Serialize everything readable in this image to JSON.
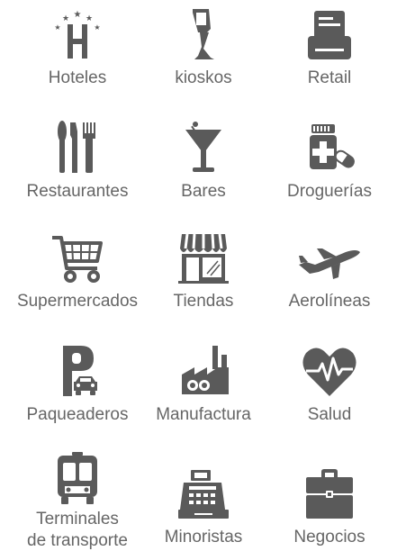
{
  "colors": {
    "icon": "#5a5a5a",
    "text": "#666666",
    "background": "#ffffff"
  },
  "items": [
    {
      "label": "Hoteles",
      "icon": "hotel-icon"
    },
    {
      "label": "kioskos",
      "icon": "kiosk-icon"
    },
    {
      "label": "Retail",
      "icon": "retail-printer-icon"
    },
    {
      "label": "Restaurantes",
      "icon": "restaurant-utensils-icon"
    },
    {
      "label": "Bares",
      "icon": "cocktail-glass-icon"
    },
    {
      "label": "Droguerías",
      "icon": "pharmacy-icon"
    },
    {
      "label": "Supermercados",
      "icon": "shopping-cart-icon"
    },
    {
      "label": "Tiendas",
      "icon": "storefront-icon"
    },
    {
      "label": "Aerolíneas",
      "icon": "airplane-icon"
    },
    {
      "label": "Paqueaderos",
      "icon": "parking-icon"
    },
    {
      "label": "Manufactura",
      "icon": "factory-icon"
    },
    {
      "label": "Salud",
      "icon": "heart-pulse-icon"
    },
    {
      "label_line1": "Terminales",
      "label_line2": "de transporte",
      "icon": "bus-icon"
    },
    {
      "label": "Minoristas",
      "icon": "cash-register-icon"
    },
    {
      "label": "Negocios",
      "icon": "briefcase-icon"
    }
  ]
}
